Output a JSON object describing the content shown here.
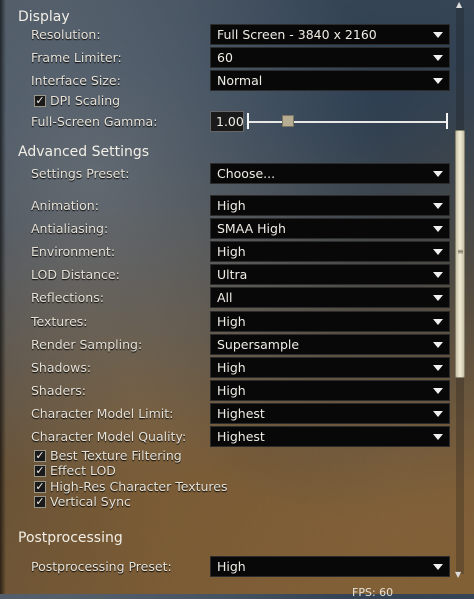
{
  "sections": {
    "display": "Display",
    "advanced": "Advanced Settings",
    "postprocessing": "Postprocessing"
  },
  "display": {
    "resolution": {
      "label": "Resolution:",
      "value": "Full Screen - 3840 x 2160"
    },
    "frame_limiter": {
      "label": "Frame Limiter:",
      "value": "60"
    },
    "interface_size": {
      "label": "Interface Size:",
      "value": "Normal"
    },
    "dpi_scaling": {
      "label": "DPI Scaling",
      "checked": true
    },
    "gamma": {
      "label": "Full-Screen Gamma:",
      "value": "1.00",
      "level": 0.2
    }
  },
  "advanced": {
    "preset": {
      "label": "Settings Preset:",
      "value": "Choose..."
    },
    "animation": {
      "label": "Animation:",
      "value": "High"
    },
    "antialiasing": {
      "label": "Antialiasing:",
      "value": "SMAA High"
    },
    "environment": {
      "label": "Environment:",
      "value": "High"
    },
    "lod_distance": {
      "label": "LOD Distance:",
      "value": "Ultra"
    },
    "reflections": {
      "label": "Reflections:",
      "value": "All"
    },
    "textures": {
      "label": "Textures:",
      "value": "High"
    },
    "render_sampling": {
      "label": "Render Sampling:",
      "value": "Supersample"
    },
    "shadows": {
      "label": "Shadows:",
      "value": "High"
    },
    "shaders": {
      "label": "Shaders:",
      "value": "High"
    },
    "char_limit": {
      "label": "Character Model Limit:",
      "value": "Highest"
    },
    "char_quality": {
      "label": "Character Model Quality:",
      "value": "Highest"
    },
    "best_texture": {
      "label": "Best Texture Filtering",
      "checked": true
    },
    "effect_lod": {
      "label": "Effect LOD",
      "checked": true
    },
    "highres_char": {
      "label": "High-Res Character Textures",
      "checked": true
    },
    "vsync": {
      "label": "Vertical Sync",
      "checked": true
    }
  },
  "postprocessing": {
    "preset": {
      "label": "Postprocessing Preset:",
      "value": "High"
    }
  },
  "fps": "FPS: 60",
  "check_mark": "✓"
}
